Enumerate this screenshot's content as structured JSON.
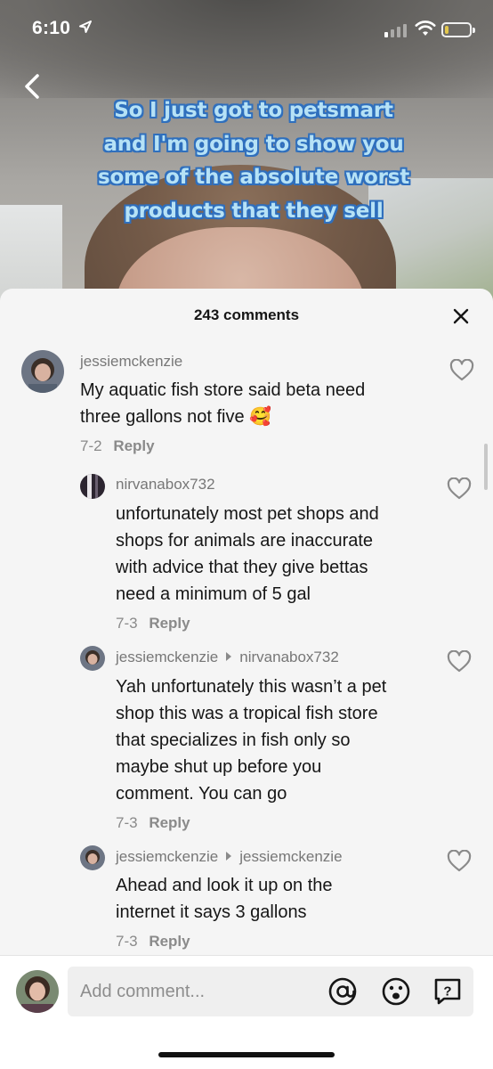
{
  "status_bar": {
    "time": "6:10",
    "location_icon": "location-arrow-icon",
    "signal_icon": "cellular-signal-icon",
    "wifi_icon": "wifi-icon",
    "battery_icon": "battery-icon",
    "battery_level": 0.15
  },
  "video": {
    "back_icon": "chevron-left-icon",
    "caption_lines": [
      "So I just got to petsmart",
      "and I'm going to show you",
      "some of the absolute worst",
      "products that they sell"
    ]
  },
  "comments_panel": {
    "title": "243 comments",
    "close_icon": "close-icon",
    "comments": [
      {
        "username": "jessiemckenzie",
        "text_lines": [
          "My aquatic fish store said beta need",
          "three gallons not five 🥰"
        ],
        "date": "7-2",
        "reply_label": "Reply"
      },
      {
        "username": "nirvanabox732",
        "text_lines": [
          "unfortunately most pet shops and",
          "shops for animals are inaccurate",
          "with advice that they give bettas",
          "need a minimum of 5 gal"
        ],
        "date": "7-3",
        "reply_label": "Reply"
      },
      {
        "username": "jessiemckenzie",
        "reply_to": "nirvanabox732",
        "text_lines": [
          "Yah unfortunately this wasn’t a pet",
          "shop this was a tropical fish store",
          "that specializes in fish only so",
          "maybe shut up before you",
          "comment. You can go"
        ],
        "date": "7-3",
        "reply_label": "Reply"
      },
      {
        "username": "jessiemckenzie",
        "reply_to": "jessiemckenzie",
        "text_lines": [
          "Ahead and look it up on the",
          "internet it says 3 gallons"
        ],
        "date": "7-3",
        "reply_label": "Reply"
      }
    ]
  },
  "comment_input": {
    "placeholder": "Add comment...",
    "icons": [
      "at-mention-icon",
      "emoji-icon",
      "question-icon"
    ]
  },
  "colors": {
    "caption_fill": "#b6e2f6",
    "caption_outline": "#2f6fbd",
    "sheet_bg": "#f5f5f5",
    "text_primary": "#161616",
    "text_secondary": "#8a8a8a"
  }
}
